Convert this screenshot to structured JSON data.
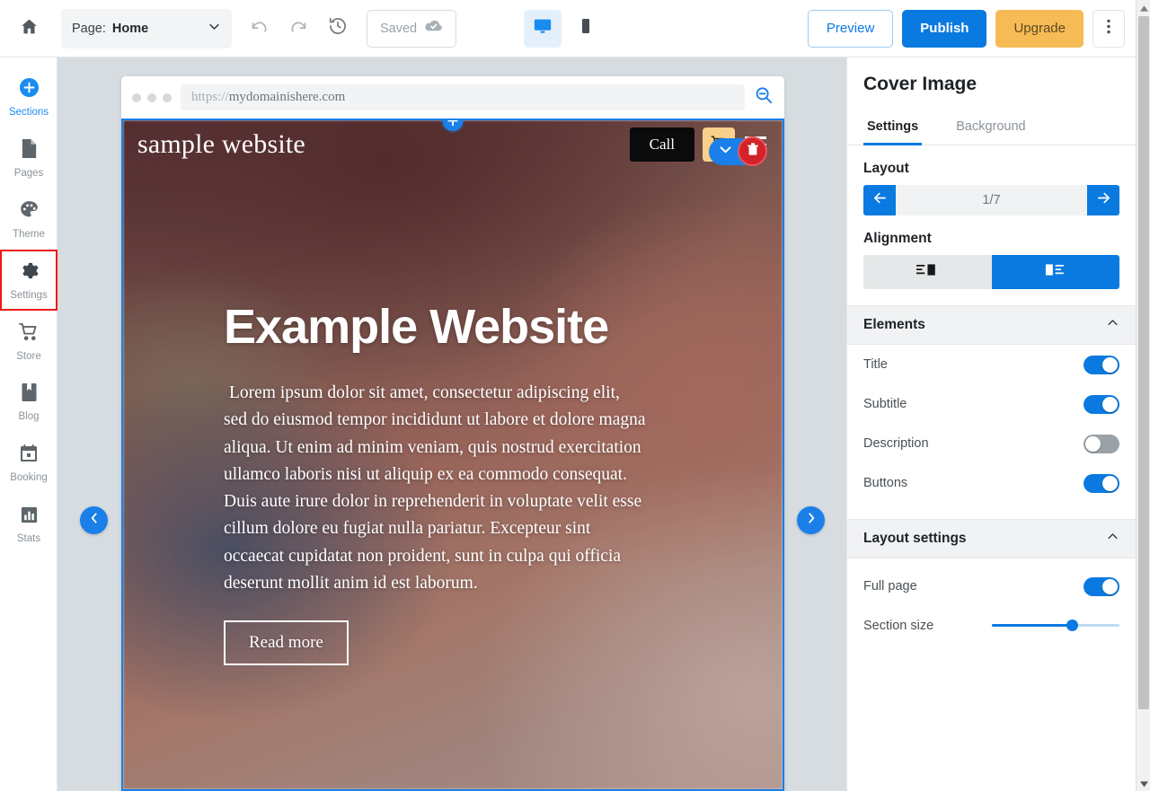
{
  "toolbar": {
    "home_icon": "home-icon",
    "page_label": "Page:",
    "page_value": "Home",
    "undo_icon": "undo-icon",
    "redo_icon": "redo-icon",
    "history_icon": "history-icon",
    "saved_label": "Saved",
    "saved_icon": "cloud-check-icon",
    "desktop_icon": "desktop-icon",
    "mobile_icon": "mobile-icon",
    "preview_label": "Preview",
    "publish_label": "Publish",
    "upgrade_label": "Upgrade",
    "kebab_icon": "more-vertical-icon"
  },
  "sidebar": {
    "items": [
      {
        "label": "Sections",
        "icon": "plus-circle-icon",
        "active": true,
        "highlighted": false
      },
      {
        "label": "Pages",
        "icon": "page-icon",
        "active": false,
        "highlighted": false
      },
      {
        "label": "Theme",
        "icon": "palette-icon",
        "active": false,
        "highlighted": false
      },
      {
        "label": "Settings",
        "icon": "gear-icon",
        "active": false,
        "highlighted": true
      },
      {
        "label": "Store",
        "icon": "cart-icon",
        "active": false,
        "highlighted": false
      },
      {
        "label": "Blog",
        "icon": "book-icon",
        "active": false,
        "highlighted": false
      },
      {
        "label": "Booking",
        "icon": "calendar-icon",
        "active": false,
        "highlighted": false
      },
      {
        "label": "Stats",
        "icon": "bar-chart-icon",
        "active": false,
        "highlighted": false
      }
    ]
  },
  "canvas": {
    "browser": {
      "url_scheme": "https://",
      "url_domain": "mydomainishere.com",
      "zoom_out_icon": "zoom-out-icon"
    },
    "site": {
      "brand": "sample website",
      "call_label": "Call",
      "cart_icon": "shopping-cart-icon",
      "menu_icon": "hamburger-menu-icon",
      "heading": "Example Website",
      "paragraph": "Lorem ipsum dolor sit amet, consectetur adipiscing elit, sed do eiusmod tempor incididunt ut labore et dolore magna aliqua. Ut enim ad minim veniam, quis nostrud exercitation ullamco laboris nisi ut aliquip ex ea commodo consequat. Duis aute irure dolor in reprehenderit in voluptate velit esse cillum dolore eu fugiat nulla pariatur. Excepteur sint occaecat cupidatat non proident, sunt in culpa qui officia deserunt mollit anim id est laborum.",
      "button_label": "Read more"
    },
    "section_controls": {
      "add_icon": "plus-icon",
      "collapse_icon": "chevron-down-icon",
      "delete_icon": "trash-icon"
    },
    "nav": {
      "prev_icon": "chevron-left-icon",
      "next_icon": "chevron-right-icon"
    }
  },
  "panel": {
    "title": "Cover Image",
    "tabs": [
      {
        "label": "Settings",
        "active": true
      },
      {
        "label": "Background",
        "active": false
      }
    ],
    "layout": {
      "label": "Layout",
      "prev_icon": "arrow-left-icon",
      "next_icon": "arrow-right-icon",
      "value": "1/7"
    },
    "alignment": {
      "label": "Alignment",
      "options": [
        {
          "icon": "align-text-left-image-right-icon",
          "active": false
        },
        {
          "icon": "align-image-left-text-right-icon",
          "active": true
        }
      ]
    },
    "elements": {
      "label": "Elements",
      "collapse_icon": "chevron-up-icon",
      "rows": [
        {
          "label": "Title",
          "on": true
        },
        {
          "label": "Subtitle",
          "on": true
        },
        {
          "label": "Description",
          "on": false
        },
        {
          "label": "Buttons",
          "on": true
        }
      ]
    },
    "layout_settings": {
      "label": "Layout settings",
      "collapse_icon": "chevron-up-icon",
      "full_page": {
        "label": "Full page",
        "on": true
      },
      "section_size": {
        "label": "Section size",
        "value": 63
      }
    }
  },
  "scrollbar": {
    "up_icon": "scroll-up-arrow-icon",
    "down_icon": "scroll-down-arrow-icon"
  },
  "colors": {
    "accent": "#0a7ae0",
    "upgrade": "#f7bb56",
    "danger": "#d2232a",
    "highlight_outline": "#f01a1a"
  }
}
